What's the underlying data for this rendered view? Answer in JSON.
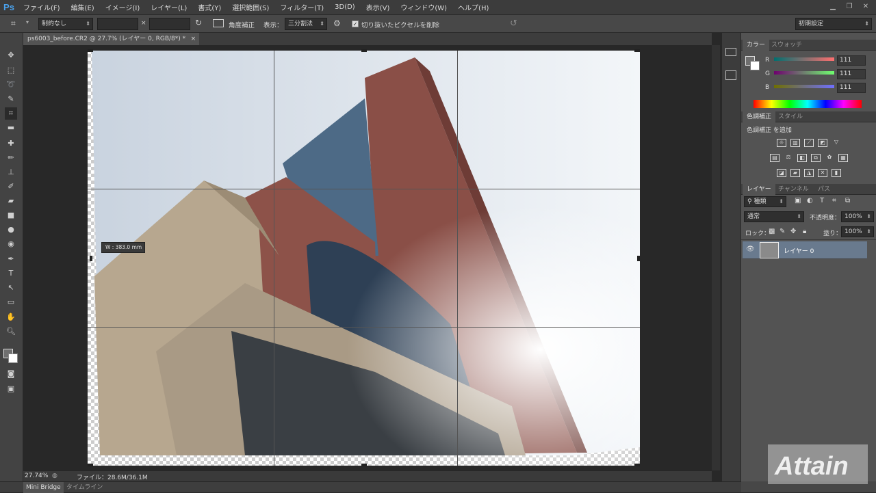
{
  "app": {
    "logo": "Ps"
  },
  "menu": [
    "ファイル(F)",
    "編集(E)",
    "イメージ(I)",
    "レイヤー(L)",
    "書式(Y)",
    "選択範囲(S)",
    "フィルター(T)",
    "3D(D)",
    "表示(V)",
    "ウィンドウ(W)",
    "ヘルプ(H)"
  ],
  "options": {
    "ratio": "制約なし",
    "times": "×",
    "straighten": "角度補正",
    "view_label": "表示：",
    "view_value": "三分割法",
    "delete_cropped": "切り抜いたピクセルを削除",
    "workspace": "初期設定"
  },
  "document": {
    "tab_title": "ps6003_before.CR2 @ 27.7% (レイヤー 0, RGB/8*) *",
    "close": "×"
  },
  "tooltip": "W : 383.0 mm",
  "status": {
    "zoom": "27.74%",
    "file_info": "ファイル：28.6M/36.1M"
  },
  "bottom_tabs": [
    "Mini Bridge",
    "タイムライン"
  ],
  "color_panel": {
    "tabs": [
      "カラー",
      "スウォッチ"
    ],
    "channels": [
      {
        "name": "R",
        "value": "111"
      },
      {
        "name": "G",
        "value": "111"
      },
      {
        "name": "B",
        "value": "111"
      }
    ]
  },
  "adjustments_panel": {
    "tabs": [
      "色調補正",
      "スタイル"
    ],
    "title": "色調補正 を追加"
  },
  "layers_panel": {
    "tabs": [
      "レイヤー",
      "チャンネル",
      "パス"
    ],
    "kind": "種類",
    "blend": "通常",
    "opacity_label": "不透明度：",
    "opacity": "100%",
    "lock_label": "ロック：",
    "fill_label": "塗り：",
    "fill": "100%",
    "layer_name": "レイヤー 0"
  },
  "watermark": "Attain",
  "colors": {
    "accent": "#4aa3ef",
    "selected_layer": "#697a8e",
    "panel": "#535353",
    "chrome": "#3c3c3c"
  }
}
